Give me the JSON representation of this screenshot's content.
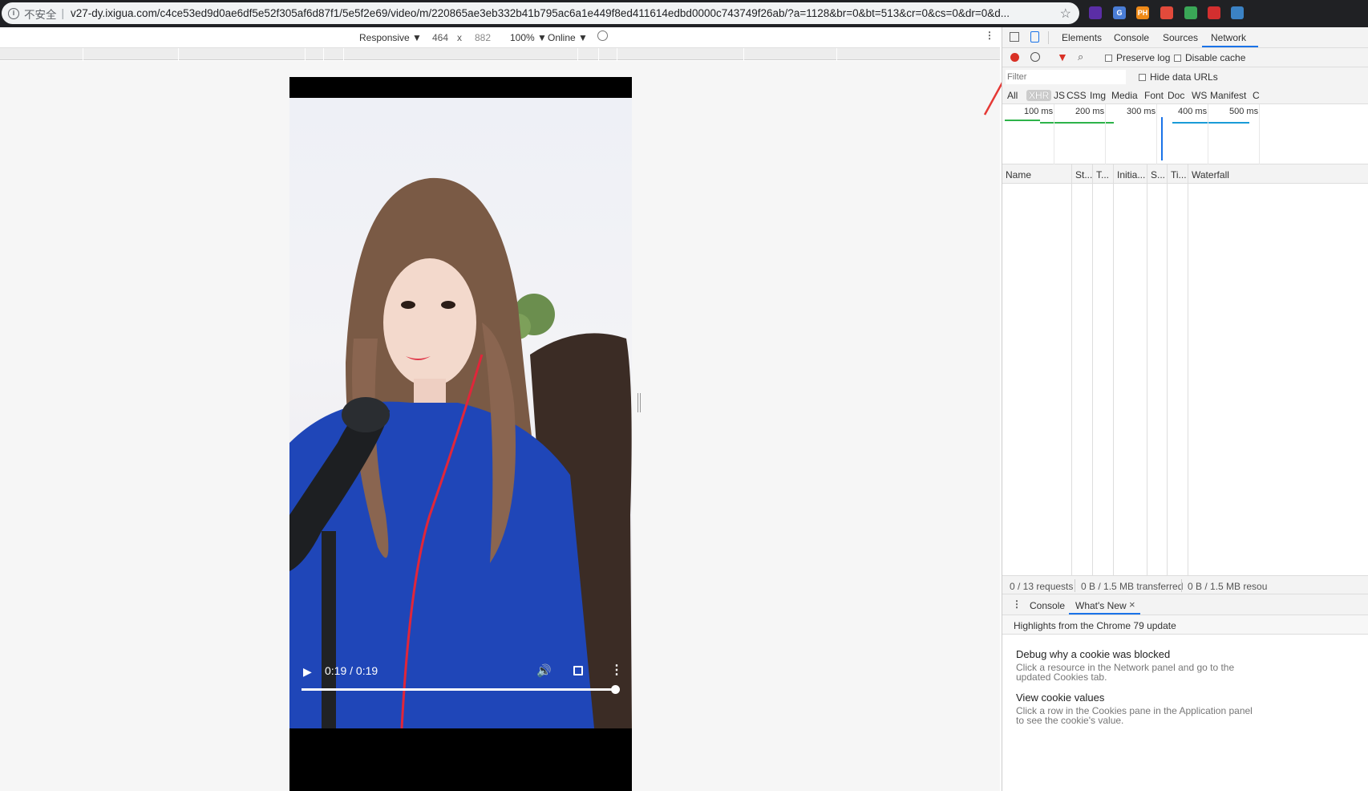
{
  "browser": {
    "security_label": "不安全",
    "separator": "|",
    "url": "v27-dy.ixigua.com/c4ce53ed9d0ae6df5e52f305af6d87f1/5e5f2e69/video/m/220865ae3eb332b41b795ac6a1e449f8ed411614edbd0000c743749f26ab/?a=1128&br=0&bt=513&cr=0&cs=0&dr=0&d...",
    "extensions": [
      {
        "name": "ext-purple-icon",
        "text": "",
        "color": "#5b2ea6"
      },
      {
        "name": "ext-translate-icon",
        "text": "G",
        "color": "#4a7dd6"
      },
      {
        "name": "ext-ph-icon",
        "text": "PH",
        "color": "#ef8a18"
      },
      {
        "name": "ext-pin-icon",
        "text": "",
        "color": "#e24a3b"
      },
      {
        "name": "ext-sheet-icon",
        "text": "",
        "color": "#3aa757"
      },
      {
        "name": "ext-red-icon",
        "text": "",
        "color": "#d32f2f"
      },
      {
        "name": "ext-blue-icon",
        "text": "",
        "color": "#3b82c4"
      }
    ]
  },
  "device_toolbar": {
    "device": "Responsive ▼",
    "width": "464",
    "x": "x",
    "height": "882",
    "zoom": "100% ▼",
    "network": "Online ▼"
  },
  "video": {
    "time": "0:19 / 0:19",
    "progress": 1.0
  },
  "devtools": {
    "tabs": [
      "Elements",
      "Console",
      "Sources",
      "Network"
    ],
    "active_tab": "Network",
    "toolbar": {
      "preserve_log": "Preserve log",
      "disable_cache": "Disable cache"
    },
    "filter_placeholder": "Filter",
    "hide_data_urls": "Hide data URLs",
    "type_filters": [
      "All",
      "XHR",
      "JS",
      "CSS",
      "Img",
      "Media",
      "Font",
      "Doc",
      "WS",
      "Manifest",
      "C"
    ],
    "active_type": "XHR",
    "timeline_ticks": [
      "100 ms",
      "200 ms",
      "300 ms",
      "400 ms",
      "500 ms"
    ],
    "columns": [
      "Name",
      "St...",
      "T...",
      "Initia...",
      "S...",
      "Ti...",
      "Waterfall"
    ],
    "status": {
      "requests": "0 / 13 requests",
      "transferred": "0 B / 1.5 MB transferred",
      "resources": "0 B / 1.5 MB resou"
    },
    "drawer": {
      "tabs": [
        "Console",
        "What's New"
      ],
      "close": "×",
      "highlights": "Highlights from the Chrome 79 update",
      "items": [
        {
          "title": "Debug why a cookie was blocked",
          "desc": "Click a resource in the Network panel and go to the updated Cookies tab."
        },
        {
          "title": "View cookie values",
          "desc": "Click a row in the Cookies pane in the Application panel to see the cookie's value."
        }
      ]
    }
  },
  "colors": {
    "accent": "#1a73e8",
    "annotation": "#e53935"
  }
}
